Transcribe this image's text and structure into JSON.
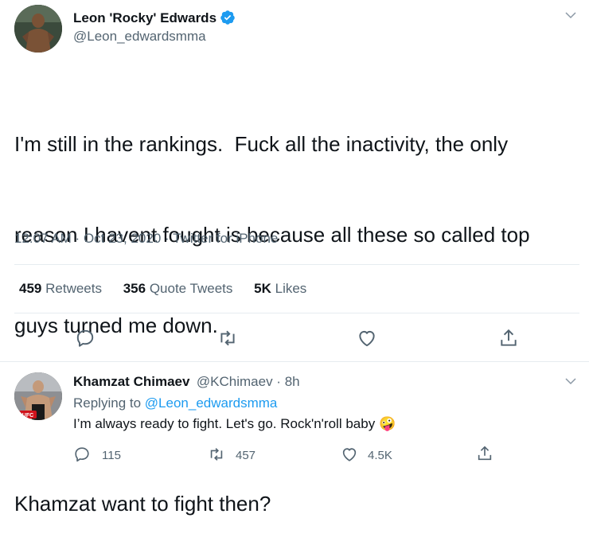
{
  "tweet": {
    "author_name": "Leon 'Rocky' Edwards",
    "author_handle": "@Leon_edwardsmma",
    "text_line1": "I'm still in the rankings.  Fuck all the inactivity, the only",
    "text_line2": "reason I havent fought is because all these so called top",
    "text_line3": "guys turned me down.",
    "text_line4": "Khamzat want to fight then?",
    "time": "12:07 AM",
    "date": "Oct 23, 2020",
    "source": "Twitter for iPhone",
    "retweets_count": "459",
    "retweets_label": "Retweets",
    "quotes_count": "356",
    "quotes_label": "Quote Tweets",
    "likes_count": "5K",
    "likes_label": "Likes"
  },
  "reply": {
    "author_name": "Khamzat Chimaev",
    "author_handle": "@KChimaev",
    "age": "8h",
    "replying_label": "Replying to",
    "replying_handle": "@Leon_edwardsmma",
    "text": "I’m always ready to fight. Let's go. Rock'n'roll baby",
    "emoji": "🤪",
    "reply_count": "115",
    "retweet_count": "457",
    "like_count": "4.5K",
    "avatar_badge": "UFC"
  },
  "icons": {
    "verified": "verified-badge-icon",
    "more": "chevron-down-icon",
    "reply": "comment-icon",
    "retweet": "retweet-icon",
    "like": "heart-icon",
    "share": "share-icon"
  },
  "colors": {
    "accent": "#1d9bf0",
    "text": "#0f1419",
    "secondary": "#536471"
  }
}
